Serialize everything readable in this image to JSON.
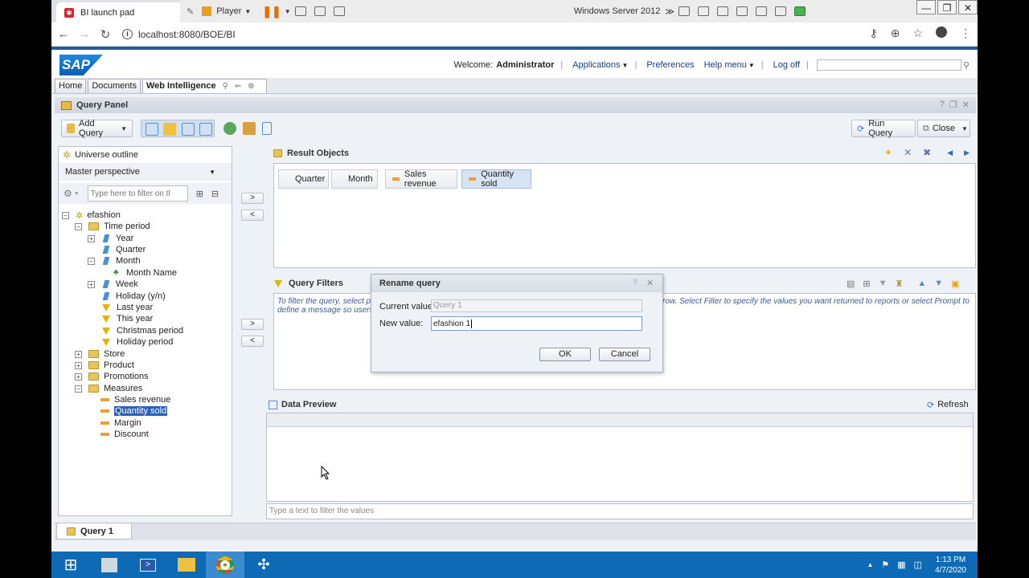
{
  "browser": {
    "tab_title": "BI launch pad",
    "url": "localhost:8080/BOE/BI",
    "vm_player_label": "Player",
    "vm_os_label": "Windows Server 2012"
  },
  "header": {
    "logo": "SAP",
    "welcome_prefix": "Welcome:",
    "user": "Administrator",
    "applications": "Applications",
    "preferences": "Preferences",
    "help_menu": "Help menu",
    "log_off": "Log off"
  },
  "app_tabs": [
    "Home",
    "Documents",
    "Web Intelligence"
  ],
  "query_panel": {
    "title": "Query Panel",
    "add_query": "Add Query",
    "run_query": "Run Query",
    "close": "Close"
  },
  "left_panel": {
    "title": "Universe outline",
    "perspective": "Master perspective",
    "filter_placeholder": "Type here to filter on tl",
    "tree": {
      "root": "efashion",
      "time_period": "Time period",
      "year": "Year",
      "quarter": "Quarter",
      "month": "Month",
      "month_name": "Month Name",
      "week": "Week",
      "holiday_yn": "Holiday (y/n)",
      "last_year": "Last year",
      "this_year": "This year",
      "christmas_period": "Christmas period",
      "holiday_period": "Holiday period",
      "store": "Store",
      "product": "Product",
      "promotions": "Promotions",
      "measures": "Measures",
      "sales_revenue": "Sales revenue",
      "quantity_sold": "Quantity sold",
      "margin": "Margin",
      "discount": "Discount"
    }
  },
  "arrows": {
    "add": ">",
    "remove": "<"
  },
  "result_objects": {
    "title": "Result Objects",
    "items": [
      "Quarter",
      "Month",
      "Sales revenue",
      "Quantity sold"
    ]
  },
  "query_filters": {
    "title": "Query Filters",
    "hint_left_1": "To filter the query, select p",
    "hint_left_2": "define a message so users",
    "hint_right": "row. Select Filter to specify the values you want returned to reports or select Prompt to"
  },
  "data_preview": {
    "title": "Data Preview",
    "refresh": "Refresh",
    "filter_placeholder": "Type a text to filter the values"
  },
  "dialog": {
    "title": "Rename query",
    "current_label": "Current value:",
    "current_value": "Query 1",
    "new_label": "New value:",
    "new_value": "efashion 1",
    "ok": "OK",
    "cancel": "Cancel"
  },
  "bottom_tab": "Query 1",
  "taskbar": {
    "time": "1:13 PM",
    "date": "4/7/2020"
  }
}
